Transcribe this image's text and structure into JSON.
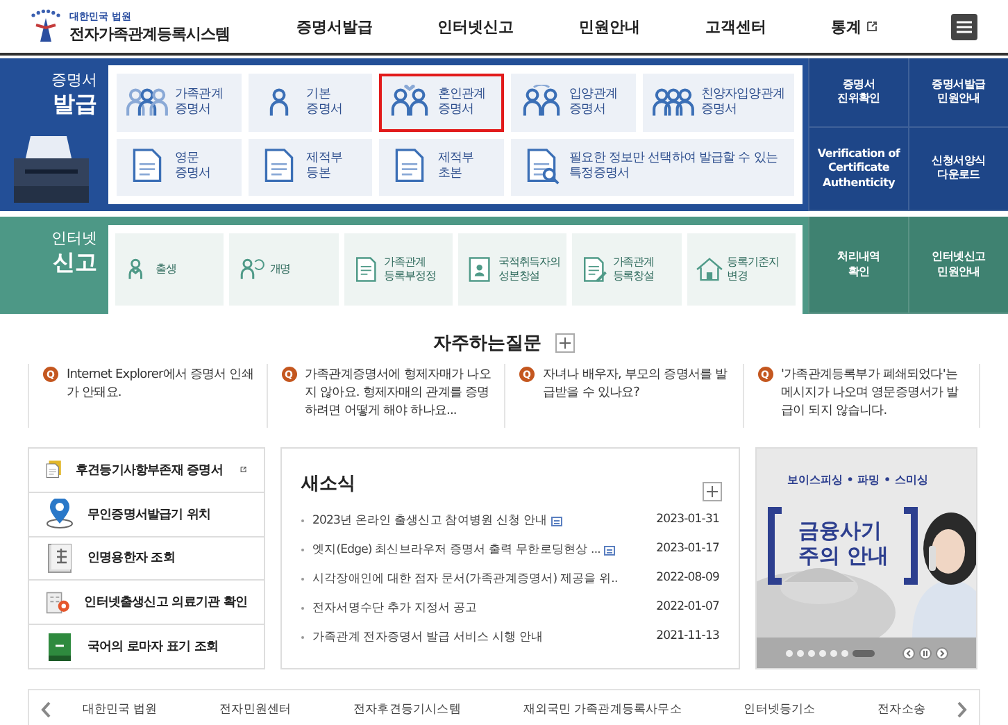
{
  "header": {
    "org": "대한민국 법원",
    "title": "전자가족관계등록시스템",
    "nav": [
      {
        "label": "증명서발급",
        "external": false
      },
      {
        "label": "인터넷신고",
        "external": false
      },
      {
        "label": "민원안내",
        "external": false
      },
      {
        "label": "고객센터",
        "external": false
      },
      {
        "label": "통계",
        "external": true
      }
    ]
  },
  "certificates": {
    "heading": [
      "증명서",
      "발급"
    ],
    "tiles": [
      {
        "lines": [
          "가족관계",
          "증명서"
        ],
        "selected": false
      },
      {
        "lines": [
          "기본",
          "증명서"
        ],
        "selected": false
      },
      {
        "lines": [
          "혼인관계",
          "증명서"
        ],
        "selected": true
      },
      {
        "lines": [
          "입양관계",
          "증명서"
        ],
        "selected": false
      },
      {
        "lines": [
          "친양자입양관계",
          "증명서"
        ],
        "selected": false
      },
      {
        "lines": [
          "영문",
          "증명서"
        ],
        "selected": false
      },
      {
        "lines": [
          "제적부",
          "등본"
        ],
        "selected": false
      },
      {
        "lines": [
          "제적부",
          "초본"
        ],
        "selected": false
      },
      {
        "lines": [
          "필요한 정보만 선택하여 발급할 수 있는",
          "특정증명서"
        ],
        "selected": false
      }
    ],
    "side": [
      {
        "lines": [
          "증명서",
          "진위확인"
        ]
      },
      {
        "lines": [
          "증명서발급",
          "민원안내"
        ]
      },
      {
        "lines": [
          "Verification of",
          "Certificate",
          "Authenticity"
        ]
      },
      {
        "lines": [
          "신청서양식",
          "다운로드"
        ]
      }
    ]
  },
  "reports": {
    "heading": [
      "인터넷",
      "신고"
    ],
    "tiles": [
      {
        "lines": [
          "출생"
        ]
      },
      {
        "lines": [
          "개명"
        ]
      },
      {
        "lines": [
          "가족관계",
          "등록부정정"
        ]
      },
      {
        "lines": [
          "국적취득자의",
          "성본창설"
        ]
      },
      {
        "lines": [
          "가족관계",
          "등록창설"
        ]
      },
      {
        "lines": [
          "등록기준지",
          "변경"
        ]
      }
    ],
    "side": [
      {
        "lines": [
          "처리내역",
          "확인"
        ]
      },
      {
        "lines": [
          "인터넷신고",
          "민원안내"
        ]
      }
    ]
  },
  "faq": {
    "title": "자주하는질문",
    "items": [
      {
        "mark": "Q",
        "text": "Internet Explorer에서 증명서 인쇄가 안돼요."
      },
      {
        "mark": "Q",
        "text": "가족관계증명서에 형제자매가 나오지 않아요. 형제자매의 관계를 증명하려면 어떻게 해야 하나요..."
      },
      {
        "mark": "Q",
        "text": "자녀나 배우자, 부모의 증명서를 발급받을 수 있나요?"
      },
      {
        "mark": "Q",
        "text": "'가족관계등록부가 폐쇄되었다'는 메시지가 나오며 영문증명서가 발급이 되지 않습니다."
      }
    ]
  },
  "quick_links": [
    {
      "label": "후견등기사항부존재 증명서",
      "external": true
    },
    {
      "label": "무인증명서발급기 위치",
      "external": false
    },
    {
      "label": "인명용한자 조회",
      "external": false
    },
    {
      "label": "인터넷출생신고 의료기관 확인",
      "external": false
    },
    {
      "label": "국어의 로마자 표기 조회",
      "external": false
    }
  ],
  "news": {
    "title": "새소식",
    "items": [
      {
        "title": "2023년 온라인 출생신고 참여병원 신청 안내",
        "attachment": true,
        "date": "2023-01-31"
      },
      {
        "title": "엣지(Edge) 최신브라우저 증명서 출력 무한로딩현상 ...",
        "attachment": true,
        "date": "2023-01-17"
      },
      {
        "title": "시각장애인에 대한 점자 문서(가족관계증명서) 제공을 위..",
        "attachment": false,
        "date": "2022-08-09"
      },
      {
        "title": "전자서명수단 추가 지정서 공고",
        "attachment": false,
        "date": "2022-01-07"
      },
      {
        "title": "가족관계 전자증명서 발급 서비스 시행 안내",
        "attachment": false,
        "date": "2021-11-13"
      }
    ]
  },
  "banner": {
    "kind": "picture",
    "subtitle": "보이스피싱 • 파밍 • 스미싱",
    "headline": [
      "금융사기",
      "주의 안내"
    ],
    "slides": [
      {
        "selected": false
      },
      {
        "selected": false
      },
      {
        "selected": false
      },
      {
        "selected": false
      },
      {
        "selected": false
      },
      {
        "selected": false
      },
      {
        "selected": true
      }
    ]
  },
  "footer_links": [
    "대한민국 법원",
    "전자민원센터",
    "전자후견등기시스템",
    "재외국민 가족관계등록사무소",
    "인터넷등기소",
    "전자소송"
  ]
}
